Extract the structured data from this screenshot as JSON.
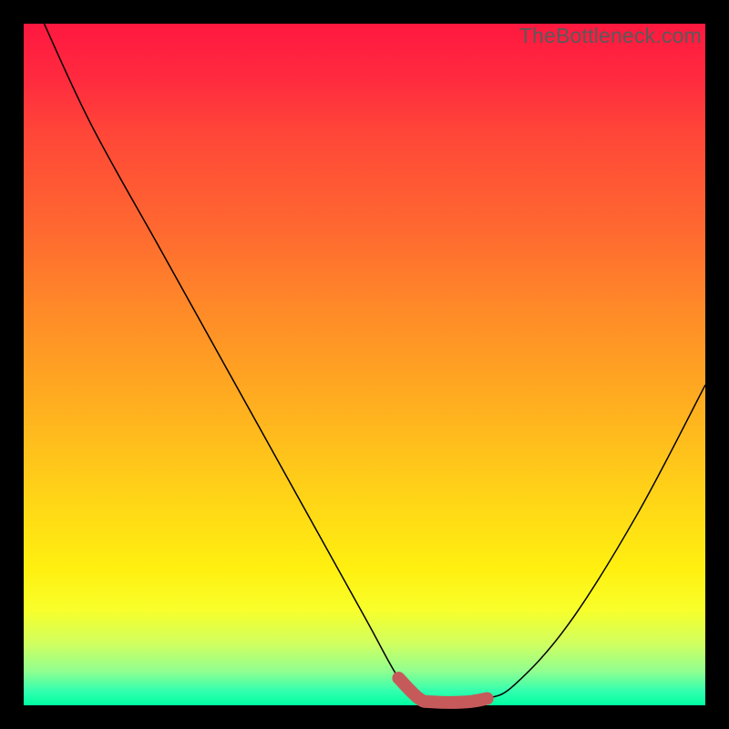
{
  "watermark": "TheBottleneck.com",
  "chart_data": {
    "type": "line",
    "title": "",
    "xlabel": "",
    "ylabel": "",
    "xlim": [
      0,
      100
    ],
    "ylim": [
      0,
      100
    ],
    "series": [
      {
        "name": "bottleneck-curve",
        "x": [
          3,
          10,
          20,
          30,
          40,
          50,
          55,
          58,
          60,
          65,
          68,
          72,
          80,
          90,
          100
        ],
        "y": [
          100,
          85,
          67,
          49,
          31,
          13,
          4,
          1,
          0.5,
          0.5,
          1,
          3,
          12,
          28,
          47
        ]
      },
      {
        "name": "optimal-zone",
        "x": [
          55,
          58,
          60,
          65,
          68
        ],
        "y": [
          4,
          1,
          0.5,
          0.5,
          1
        ]
      }
    ],
    "gradient_stops": [
      {
        "pos": 0,
        "color": "#ff183f"
      },
      {
        "pos": 100,
        "color": "#00ffa0"
      }
    ]
  }
}
